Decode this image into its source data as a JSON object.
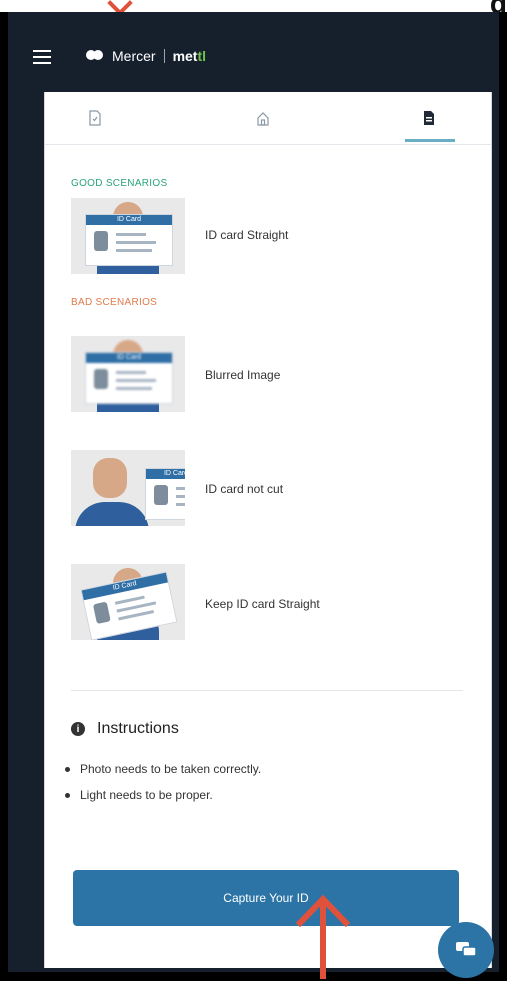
{
  "header": {
    "menu_icon": "hamburger-icon",
    "brand_primary": "Mercer",
    "brand_secondary_prefix": "met",
    "brand_secondary_accent": "tl",
    "brand_colors": {
      "background": "#16202d",
      "accent": "#6fc24a"
    }
  },
  "tabs": [
    {
      "icon": "document-icon"
    },
    {
      "icon": "home-icon"
    },
    {
      "icon": "document-filled-icon",
      "active": true
    }
  ],
  "sections": {
    "good_label": "GOOD SCENARIOS",
    "bad_label": "BAD SCENARIOS"
  },
  "scenarios": {
    "good": [
      {
        "label": "ID card Straight",
        "card_label": "ID Card"
      }
    ],
    "bad": [
      {
        "label": "Blurred Image",
        "card_label": "ID Card"
      },
      {
        "label": "ID card not cut",
        "card_label": "ID Card"
      },
      {
        "label": "Keep ID card Straight",
        "card_label": "ID Card"
      }
    ]
  },
  "instructions": {
    "title": "Instructions",
    "items": [
      "Photo needs to be taken correctly.",
      "Light needs to be proper."
    ]
  },
  "actions": {
    "capture_label": "Capture Your ID"
  },
  "colors": {
    "good_label": "#2aa37a",
    "bad_label": "#e07a4a",
    "button": "#2b74a5",
    "annotation_arrow": "#e0513b"
  },
  "floating": {
    "chat_icon": "chat-icon"
  }
}
